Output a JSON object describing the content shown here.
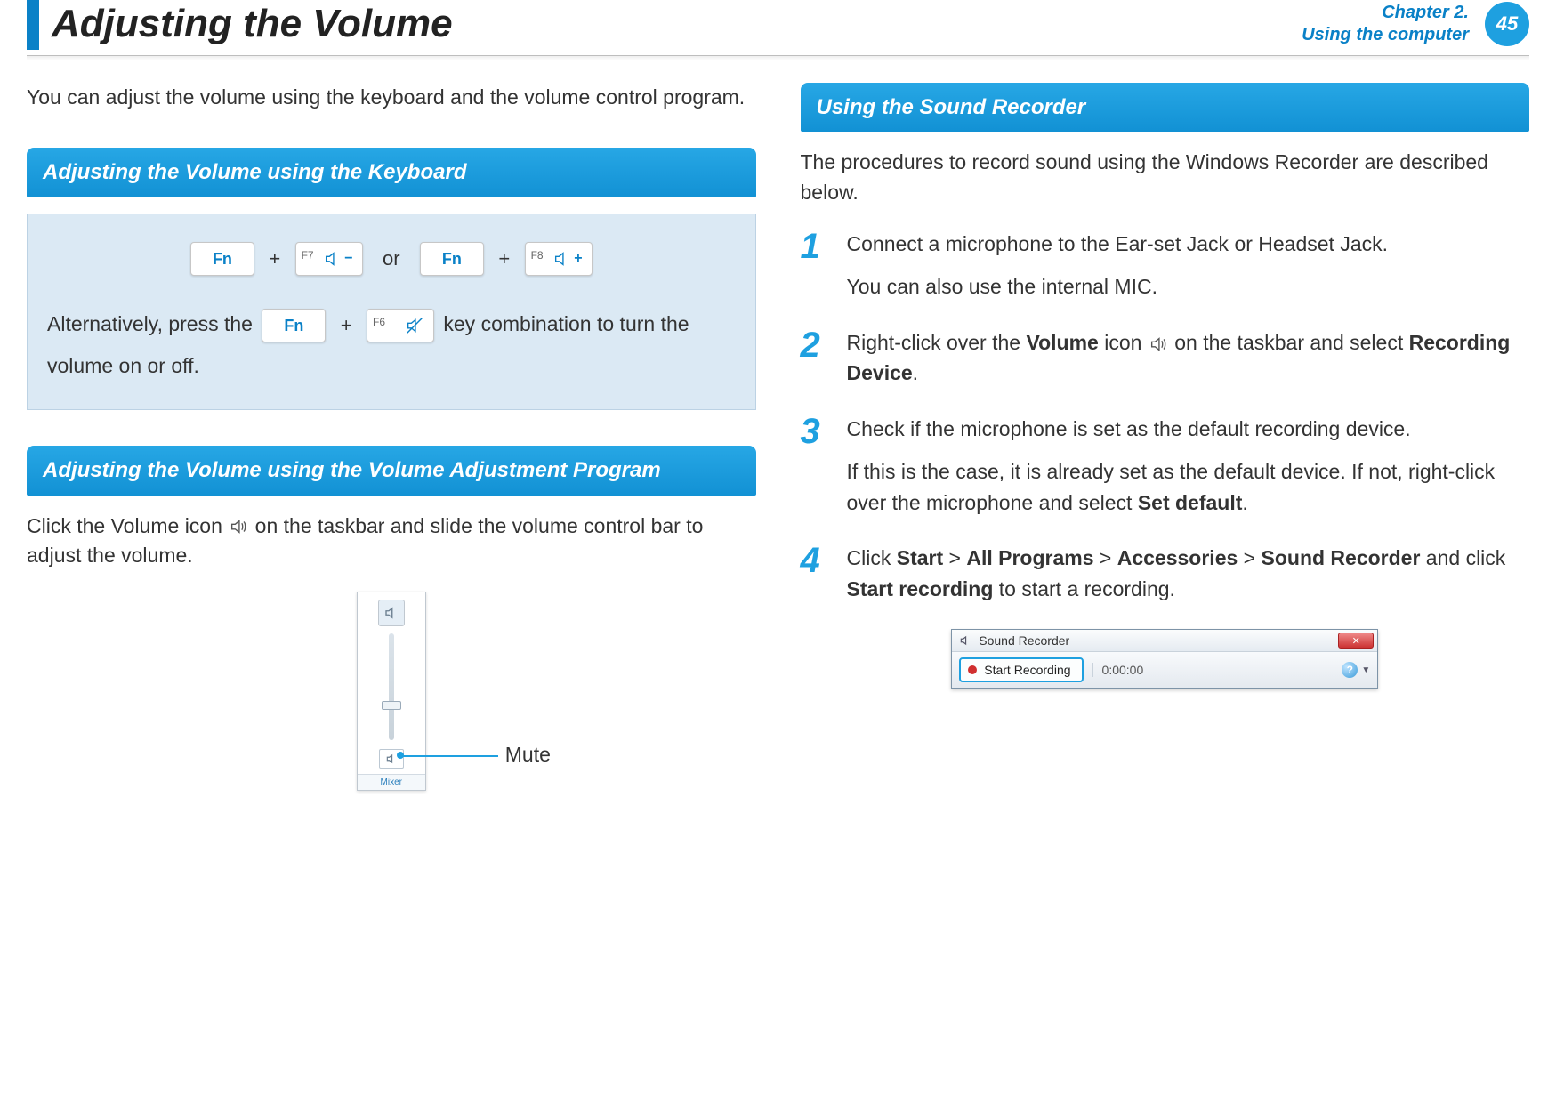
{
  "header": {
    "title": "Adjusting the Volume",
    "chapter_line1": "Chapter 2.",
    "chapter_line2": "Using the computer",
    "page_number": "45"
  },
  "left": {
    "intro": "You can adjust the volume using the keyboard and the volume control program.",
    "section1_title": "Adjusting the Volume using the Keyboard",
    "keys": {
      "fn": "Fn",
      "f7": "F7",
      "f8": "F8",
      "f6": "F6",
      "or": "or",
      "plus": "+"
    },
    "alt_prefix": "Alternatively, press the ",
    "alt_suffix": " key combination to turn the volume on or off.",
    "section2_title": "Adjusting the Volume using the Volume Adjustment Program",
    "section2_text_a": "Click the Volume icon ",
    "section2_text_b": " on the taskbar and slide the volume control bar to adjust the volume.",
    "vol_widget": {
      "mixer": "Mixer",
      "callout": "Mute"
    }
  },
  "right": {
    "section_title": "Using the Sound Recorder",
    "intro": "The procedures to record sound using the Windows Recorder are described below.",
    "steps": {
      "1": {
        "line1": "Connect a microphone to the Ear-set Jack or Headset Jack.",
        "line2": "You can also use the internal MIC."
      },
      "2": {
        "pre": "Right-click over the ",
        "b1": "Volume",
        "mid": " icon ",
        "post1": " on the taskbar and select ",
        "b2": "Recording Device",
        "end": "."
      },
      "3": {
        "line1": "Check if the microphone is set as the default recording device.",
        "line2a": "If this is the case, it is already set as the default device. If not, right-click over the microphone and select ",
        "b1": "Set default",
        "end": "."
      },
      "4": {
        "pre": "Click ",
        "b1": "Start",
        "sep": " > ",
        "b2": "All Programs",
        "b3": "Accessories",
        "b4": "Sound Recorder",
        "mid": " and click ",
        "b5": "Start recording",
        "post": " to start a recording."
      }
    },
    "recorder": {
      "title": "Sound Recorder",
      "button": "Start Recording",
      "time": "0:00:00",
      "help": "?",
      "close": "✕"
    }
  }
}
